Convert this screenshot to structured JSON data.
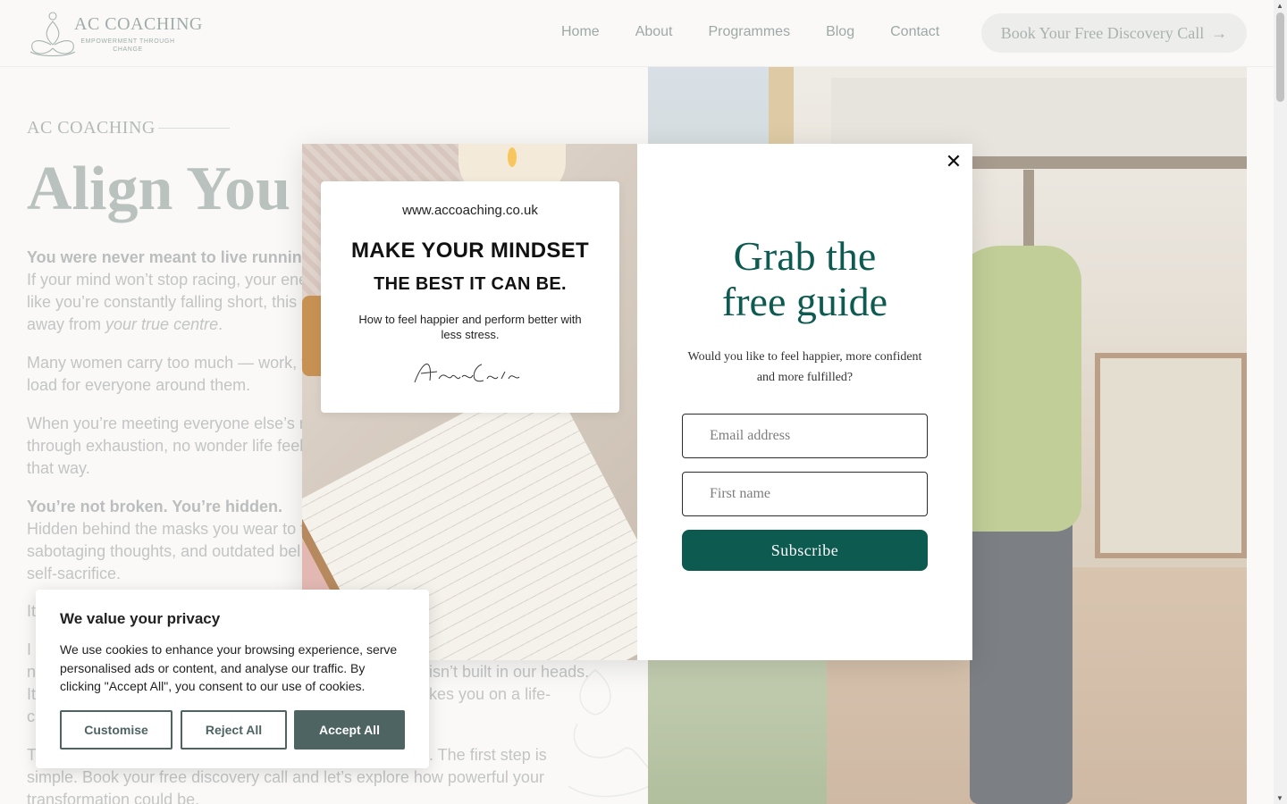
{
  "header": {
    "logo_title": "AC COACHING",
    "logo_tagline": "EMPOWERMENT THROUGH CHANGE",
    "nav": [
      "Home",
      "About",
      "Programmes",
      "Blog",
      "Contact"
    ],
    "cta_label": "Book Your Free Discovery Call",
    "cta_icon": "arrow-right-icon"
  },
  "hero": {
    "eyebrow": "AC COACHING",
    "title": "Align You",
    "p1_bold": "You were never meant to live running o",
    "p1_line1": "If your mind won’t stop racing, your ene",
    "p1_line2": "like you’re constantly falling short, this",
    "p1_line3_a": "away from ",
    "p1_line3_em": "your true centre",
    "p1_line3_b": ".",
    "p2_line1": "Many women carry too much — work, f",
    "p2_line2": "load for everyone around them.",
    "p3_line1": "When you’re meeting everyone else’s ne",
    "p3_line2": "through exhaustion, no wonder life feel",
    "p3_line3": "that way.",
    "p4_bold": "You’re not broken. You’re hidden.",
    "p4_line1": "Hidden behind the masks you wear to f",
    "p4_line2": "sabotaging thoughts, and outdated bel",
    "p4_line3": "self-sacrifice.",
    "p5_line1": "It",
    "p6_line1": "I",
    "p6_line2_a": "n",
    "p6_line2_b": "isn’t built in our heads.",
    "p6_line3_a": "It",
    "p6_line3_b": "kes you on a life-",
    "p6_line4": "c",
    "p7_line1_a": "T",
    "p7_line1_b": ". The first step is",
    "p7_line2": "simple. Book your free discovery call and let’s explore how powerful your",
    "p7_line3": "transformation could be."
  },
  "popup": {
    "card_url": "www.accoaching.co.uk",
    "card_heading_1": "MAKE YOUR MINDSET",
    "card_heading_2": "THE BEST IT CAN BE.",
    "card_subtitle": "How to feel happier and perform better with less stress.",
    "card_signature": "Angela Cairns",
    "close_icon": "close-icon",
    "title_line1": "Grab the",
    "title_line2": "free guide",
    "subtitle": "Would you like to feel happier, more confident and more fulfilled?",
    "email_placeholder": "Email address",
    "name_placeholder": "First name",
    "subscribe_label": "Subscribe",
    "accent_color": "#0d5a50"
  },
  "cookie": {
    "title": "We value your privacy",
    "text": "We use cookies to enhance your browsing experience, serve personalised ads or content, and analyse our traffic. By clicking \"Accept All\", you consent to our use of cookies.",
    "customise": "Customise",
    "reject": "Reject All",
    "accept": "Accept All",
    "button_color": "#4e6462"
  }
}
